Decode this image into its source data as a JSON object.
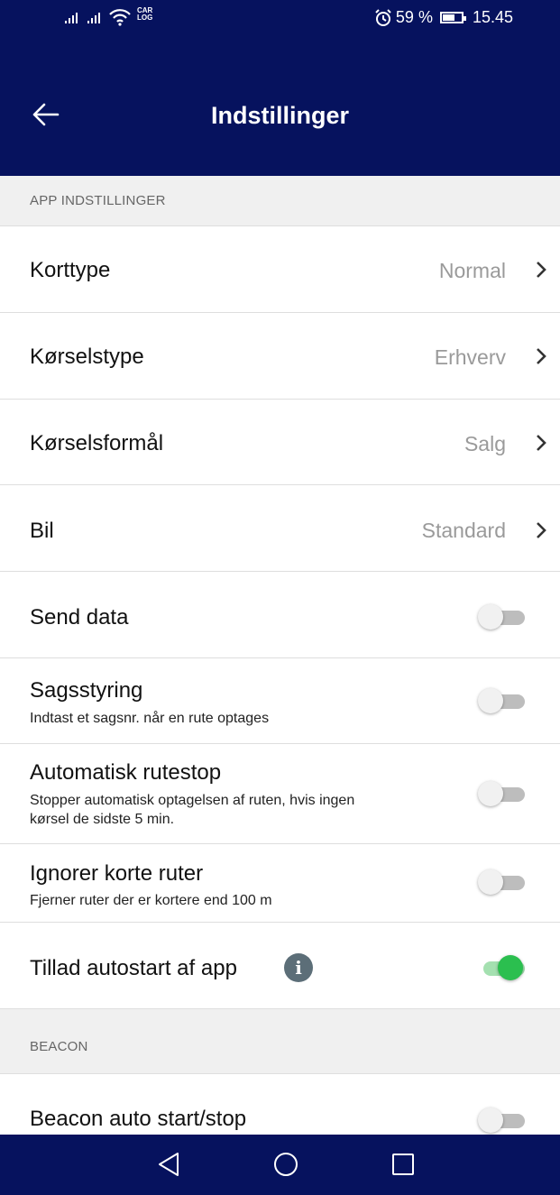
{
  "status_bar": {
    "car_log_line1": "CAR",
    "car_log_line2": "LOG",
    "battery_percent": "59 %",
    "time": "15.45"
  },
  "header": {
    "title": "Indstillinger"
  },
  "sections": {
    "app": "APP INDSTILLINGER",
    "beacon": "BEACON"
  },
  "rows": {
    "korttype": {
      "label": "Korttype",
      "value": "Normal"
    },
    "korselstype": {
      "label": "Kørselstype",
      "value": "Erhverv"
    },
    "korselsformal": {
      "label": "Kørselsformål",
      "value": "Salg"
    },
    "bil": {
      "label": "Bil",
      "value": "Standard"
    },
    "send_data": {
      "label": "Send data",
      "enabled": false
    },
    "sagsstyring": {
      "label": "Sagsstyring",
      "subtitle": "Indtast et sagsnr. når en rute optages",
      "enabled": false
    },
    "auto_rutestop": {
      "label": "Automatisk rutestop",
      "subtitle_line1": "Stopper automatisk optagelsen af ruten, hvis ingen",
      "subtitle_line2": "kørsel de sidste 5 min.",
      "enabled": false
    },
    "ignorer_korte": {
      "label": "Ignorer korte ruter",
      "subtitle": "Fjerner ruter der er kortere end 100 m",
      "enabled": false
    },
    "autostart": {
      "label": "Tillad autostart af app",
      "info_glyph": "i",
      "enabled": true
    },
    "beacon_auto": {
      "label": "Beacon auto start/stop",
      "enabled": false
    }
  },
  "icons": {
    "back": "arrow-left-icon",
    "chevron": "chevron-right-icon",
    "info": "info-icon",
    "nav_back": "triangle-back-icon",
    "nav_home": "circle-home-icon",
    "nav_recents": "square-recents-icon"
  },
  "colors": {
    "header_bg": "#06125e",
    "toggle_on": "#2bbf4f",
    "section_bg": "#f0f0f0"
  }
}
